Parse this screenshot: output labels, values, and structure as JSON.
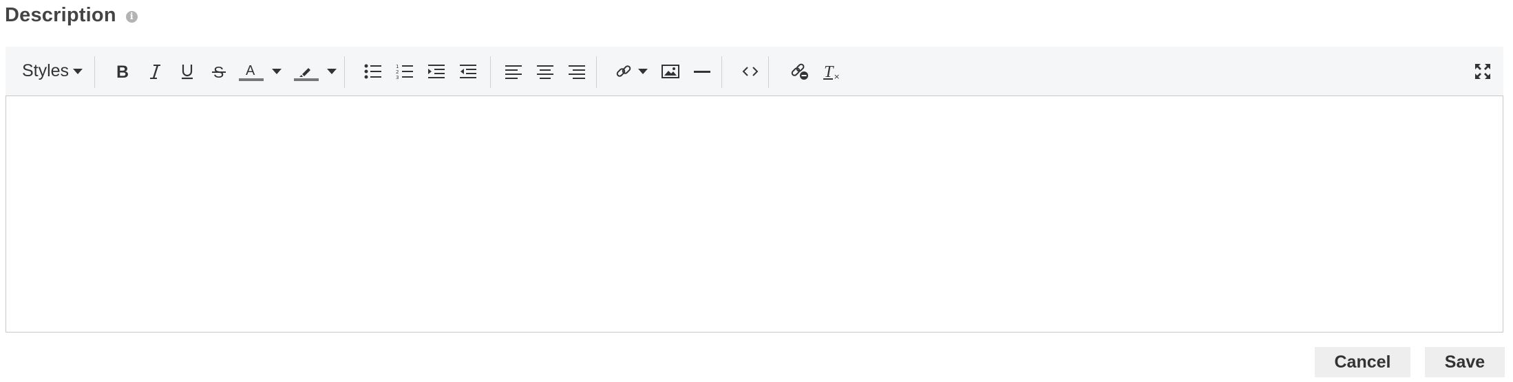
{
  "field": {
    "label": "Description",
    "info_icon": "info-icon"
  },
  "toolbar": {
    "styles_label": "Styles",
    "buttons": {
      "bold": "bold-icon",
      "italic": "italic-icon",
      "underline": "underline-icon",
      "strikethrough": "strikethrough-icon",
      "text_color": "text-color-icon",
      "highlight": "highlight-icon",
      "bulleted_list": "bulleted-list-icon",
      "numbered_list": "numbered-list-icon",
      "indent": "indent-icon",
      "outdent": "outdent-icon",
      "align_left": "align-left-icon",
      "align_center": "align-center-icon",
      "align_right": "align-right-icon",
      "link": "link-icon",
      "image": "image-icon",
      "horizontal_rule": "horizontal-rule-icon",
      "source_code": "code-icon",
      "unlink": "unlink-icon",
      "clear_formatting": "clear-formatting-icon",
      "fullscreen": "fullscreen-icon"
    }
  },
  "editor": {
    "content": ""
  },
  "actions": {
    "cancel_label": "Cancel",
    "save_label": "Save"
  },
  "colors": {
    "toolbar_bg": "#f5f6f7",
    "button_bg": "#eeeeee",
    "text": "#333333"
  }
}
